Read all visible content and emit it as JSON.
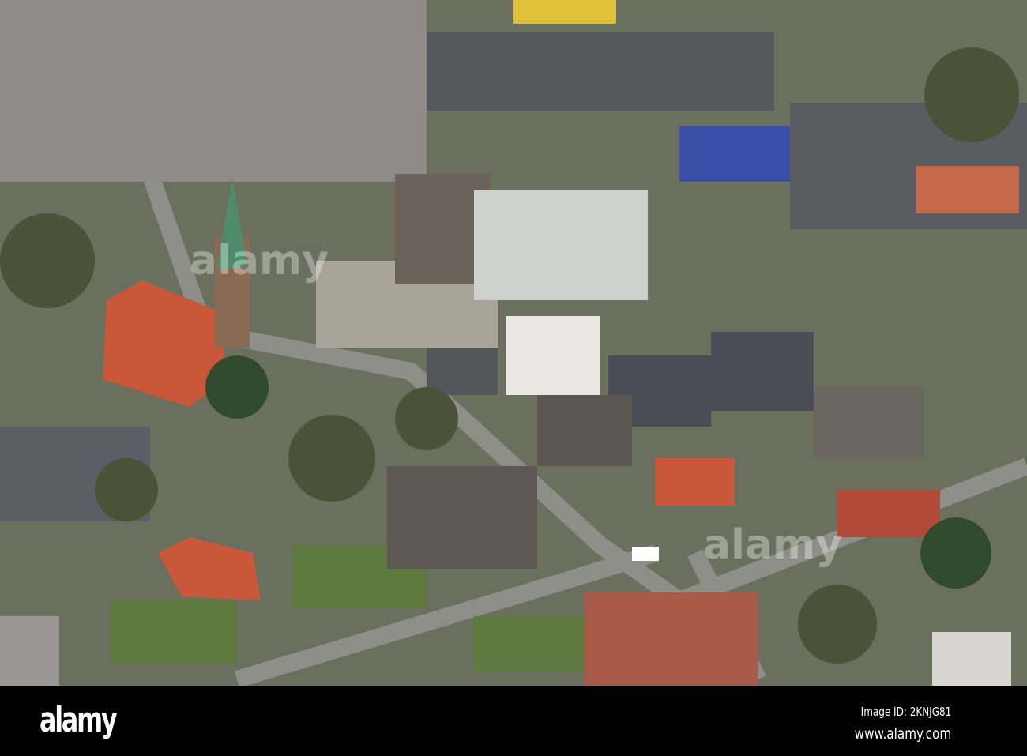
{
  "photo": {
    "subject": "aerial-town-view",
    "colors": {
      "ground": "#6b6f5e",
      "road": "#8a8a86",
      "roof_dark": "#4a4d55",
      "roof_red": "#c9573a",
      "roof_blue": "#3a4fa8",
      "spire": "#4f8a6a",
      "tree": "#4a5238",
      "wall": "#e4e0d6"
    }
  },
  "watermark": {
    "text": "alamy"
  },
  "banner": {
    "logo": "alamy",
    "image_id": "Image ID: 2KNJG81",
    "url": "www.alamy.com"
  }
}
